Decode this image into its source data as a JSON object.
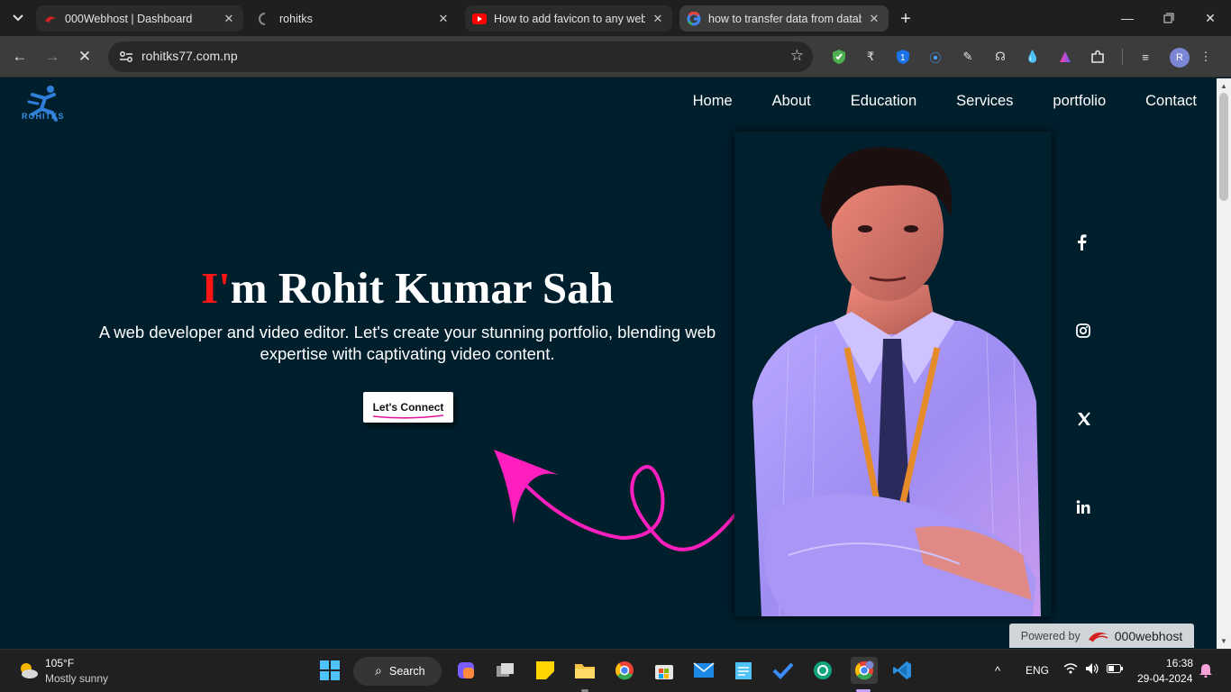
{
  "browser": {
    "tabs": [
      {
        "title": "000Webhost | Dashboard",
        "icon": "webhost-icon",
        "active": false
      },
      {
        "title": "rohitks",
        "icon": "loading-spinner-icon",
        "active": false
      },
      {
        "title": "How to add favicon to any website",
        "icon": "youtube-icon",
        "active": false
      },
      {
        "title": "how to transfer data from database",
        "icon": "google-icon",
        "active": true
      }
    ],
    "url": "rohitks77.com.np"
  },
  "site": {
    "logo_text": "ROHITKS",
    "nav": [
      "Home",
      "About",
      "Education",
      "Services",
      "portfolio",
      "Contact"
    ],
    "hero": {
      "title_accent": "I'",
      "title_rest": "m Rohit Kumar Sah",
      "subtitle": "A web developer and video editor. Let's create your stunning portfolio, blending web expertise with captivating video content.",
      "cta": "Let's Connect"
    },
    "social": [
      "facebook-icon",
      "instagram-icon",
      "x-icon",
      "linkedin-icon"
    ],
    "powered_by": "Powered by",
    "powered_brand": "000webhost",
    "accent_color": "#ff1515",
    "background_color": "#001f2d",
    "arrow_color": "#ff1fbf"
  },
  "taskbar": {
    "weather_temp": "105°F",
    "weather_desc": "Mostly sunny",
    "search_label": "Search",
    "language": "ENG",
    "time": "16:38",
    "date": "29-04-2024"
  }
}
